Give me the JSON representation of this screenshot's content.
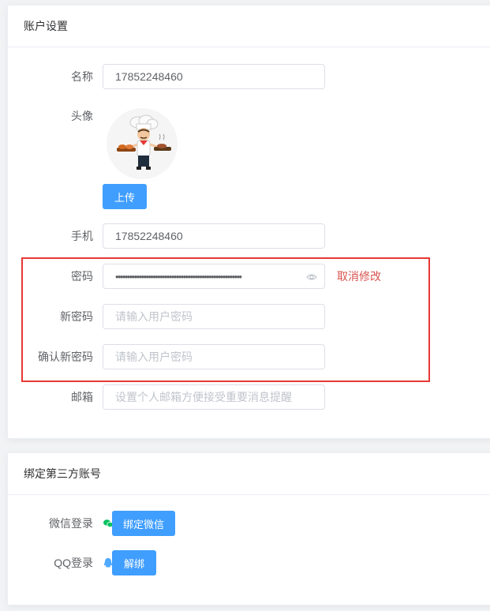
{
  "account": {
    "header": "账户设置",
    "name_label": "名称",
    "name_value": "17852248460",
    "avatar_label": "头像",
    "upload_label": "上传",
    "phone_label": "手机",
    "phone_value": "17852248460",
    "password_label": "密码",
    "password_mask": "••••••••••••••••••••••••••••••••••••••••••••••••••••••",
    "cancel_edit_label": "取消修改",
    "new_password_label": "新密码",
    "new_password_placeholder": "请输入用户密码",
    "confirm_password_label": "确认新密码",
    "confirm_password_placeholder": "请输入用户密码",
    "email_label": "邮箱",
    "email_placeholder": "设置个人邮箱方便接受重要消息提醒"
  },
  "bind": {
    "header": "绑定第三方账号",
    "wechat_label": "微信登录",
    "wechat_button": "绑定微信",
    "qq_label": "QQ登录",
    "qq_button": "解绑"
  },
  "colors": {
    "primary": "#409eff",
    "highlight": "#e53935",
    "cancel": "#d9534f",
    "wechat": "#07c160",
    "qq": "#4fa9ff"
  },
  "icons": {
    "eye": "eye-icon",
    "wechat": "wechat-icon",
    "qq": "qq-icon",
    "avatar": "chef-avatar"
  }
}
